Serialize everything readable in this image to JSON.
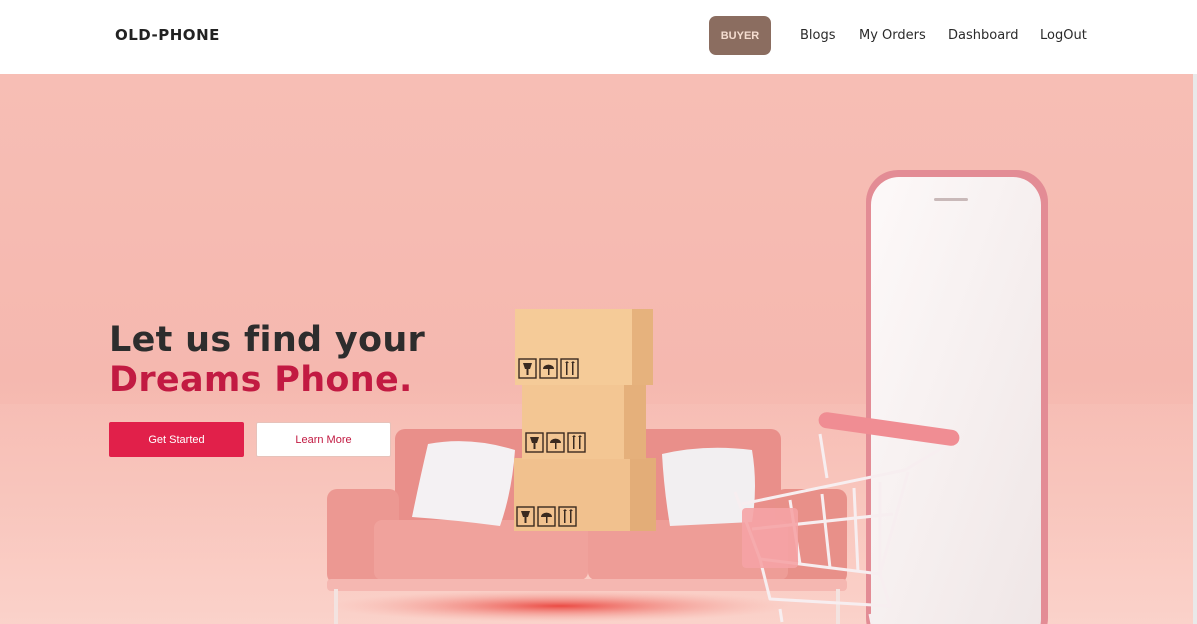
{
  "navbar": {
    "brand": "OLD-PHONE",
    "role_button": "BUYER",
    "links": {
      "blogs": "Blogs",
      "orders": "My Orders",
      "dashboard": "Dashboard",
      "logout": "LogOut"
    }
  },
  "hero": {
    "headline_line1": "Let us find your",
    "headline_line2": "Dreams Phone.",
    "primary_button": "Get Started",
    "secondary_button": "Learn More"
  },
  "colors": {
    "brand_accent": "#e1204a",
    "headline_accent": "#c21a42",
    "role_button_bg": "#8b6d60",
    "hero_bg": "#f5b8af"
  },
  "icons": [
    "fragile-glass-icon",
    "umbrella-icon",
    "this-way-up-icon",
    "shopping-cart-icon",
    "smartphone-icon",
    "sofa-icon"
  ]
}
